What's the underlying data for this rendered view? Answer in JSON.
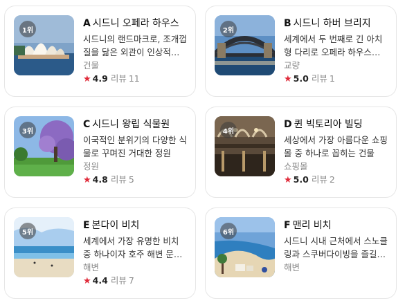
{
  "cards": [
    {
      "rank": "1위",
      "letter": "A",
      "name": "시드니 오페라 하우스",
      "desc": "시드니의 랜드마크로, 조개껍질을 닮은 외관이 인상적인 공연장",
      "category": "건물",
      "score": "4.9",
      "review_label": "리뷰",
      "reviews": "11",
      "image": "opera-house"
    },
    {
      "rank": "2위",
      "letter": "B",
      "name": "시드니 하버 브리지",
      "desc": "세계에서 두 번째로 긴 아치형 다리로 오페라 하우스와 함께 명소",
      "category": "교량",
      "score": "5.0",
      "review_label": "리뷰",
      "reviews": "1",
      "image": "harbour-bridge"
    },
    {
      "rank": "3위",
      "letter": "C",
      "name": "시드니 왕립 식물원",
      "desc": "이국적인 분위기의 다양한 식물로 꾸며진 거대한 정원",
      "category": "정원",
      "score": "4.8",
      "review_label": "리뷰",
      "reviews": "5",
      "image": "botanic-garden"
    },
    {
      "rank": "4위",
      "letter": "D",
      "name": "퀸 빅토리아 빌딩",
      "desc": "세상에서 가장 아름다운 쇼핑몰 중 하나로 꼽히는 건물",
      "category": "쇼핑몰",
      "score": "5.0",
      "review_label": "리뷰",
      "reviews": "2",
      "image": "qvb"
    },
    {
      "rank": "5위",
      "letter": "E",
      "name": "본다이 비치",
      "desc": "세계에서 가장 유명한 비치 중 하나이자 호주 해변 문화의 상징",
      "category": "해변",
      "score": "4.4",
      "review_label": "리뷰",
      "reviews": "7",
      "image": "bondi-beach"
    },
    {
      "rank": "6위",
      "letter": "F",
      "name": "맨리 비치",
      "desc": "시드니 시내 근처에서 스노클링과 스쿠버다이빙을 즐길 수 있는 해변",
      "category": "해변",
      "score": null,
      "review_label": null,
      "reviews": null,
      "image": "manly-beach"
    }
  ],
  "colors": {
    "star": "#e02b3a",
    "border": "#e6e6e6",
    "muted": "#8a8a8a"
  }
}
